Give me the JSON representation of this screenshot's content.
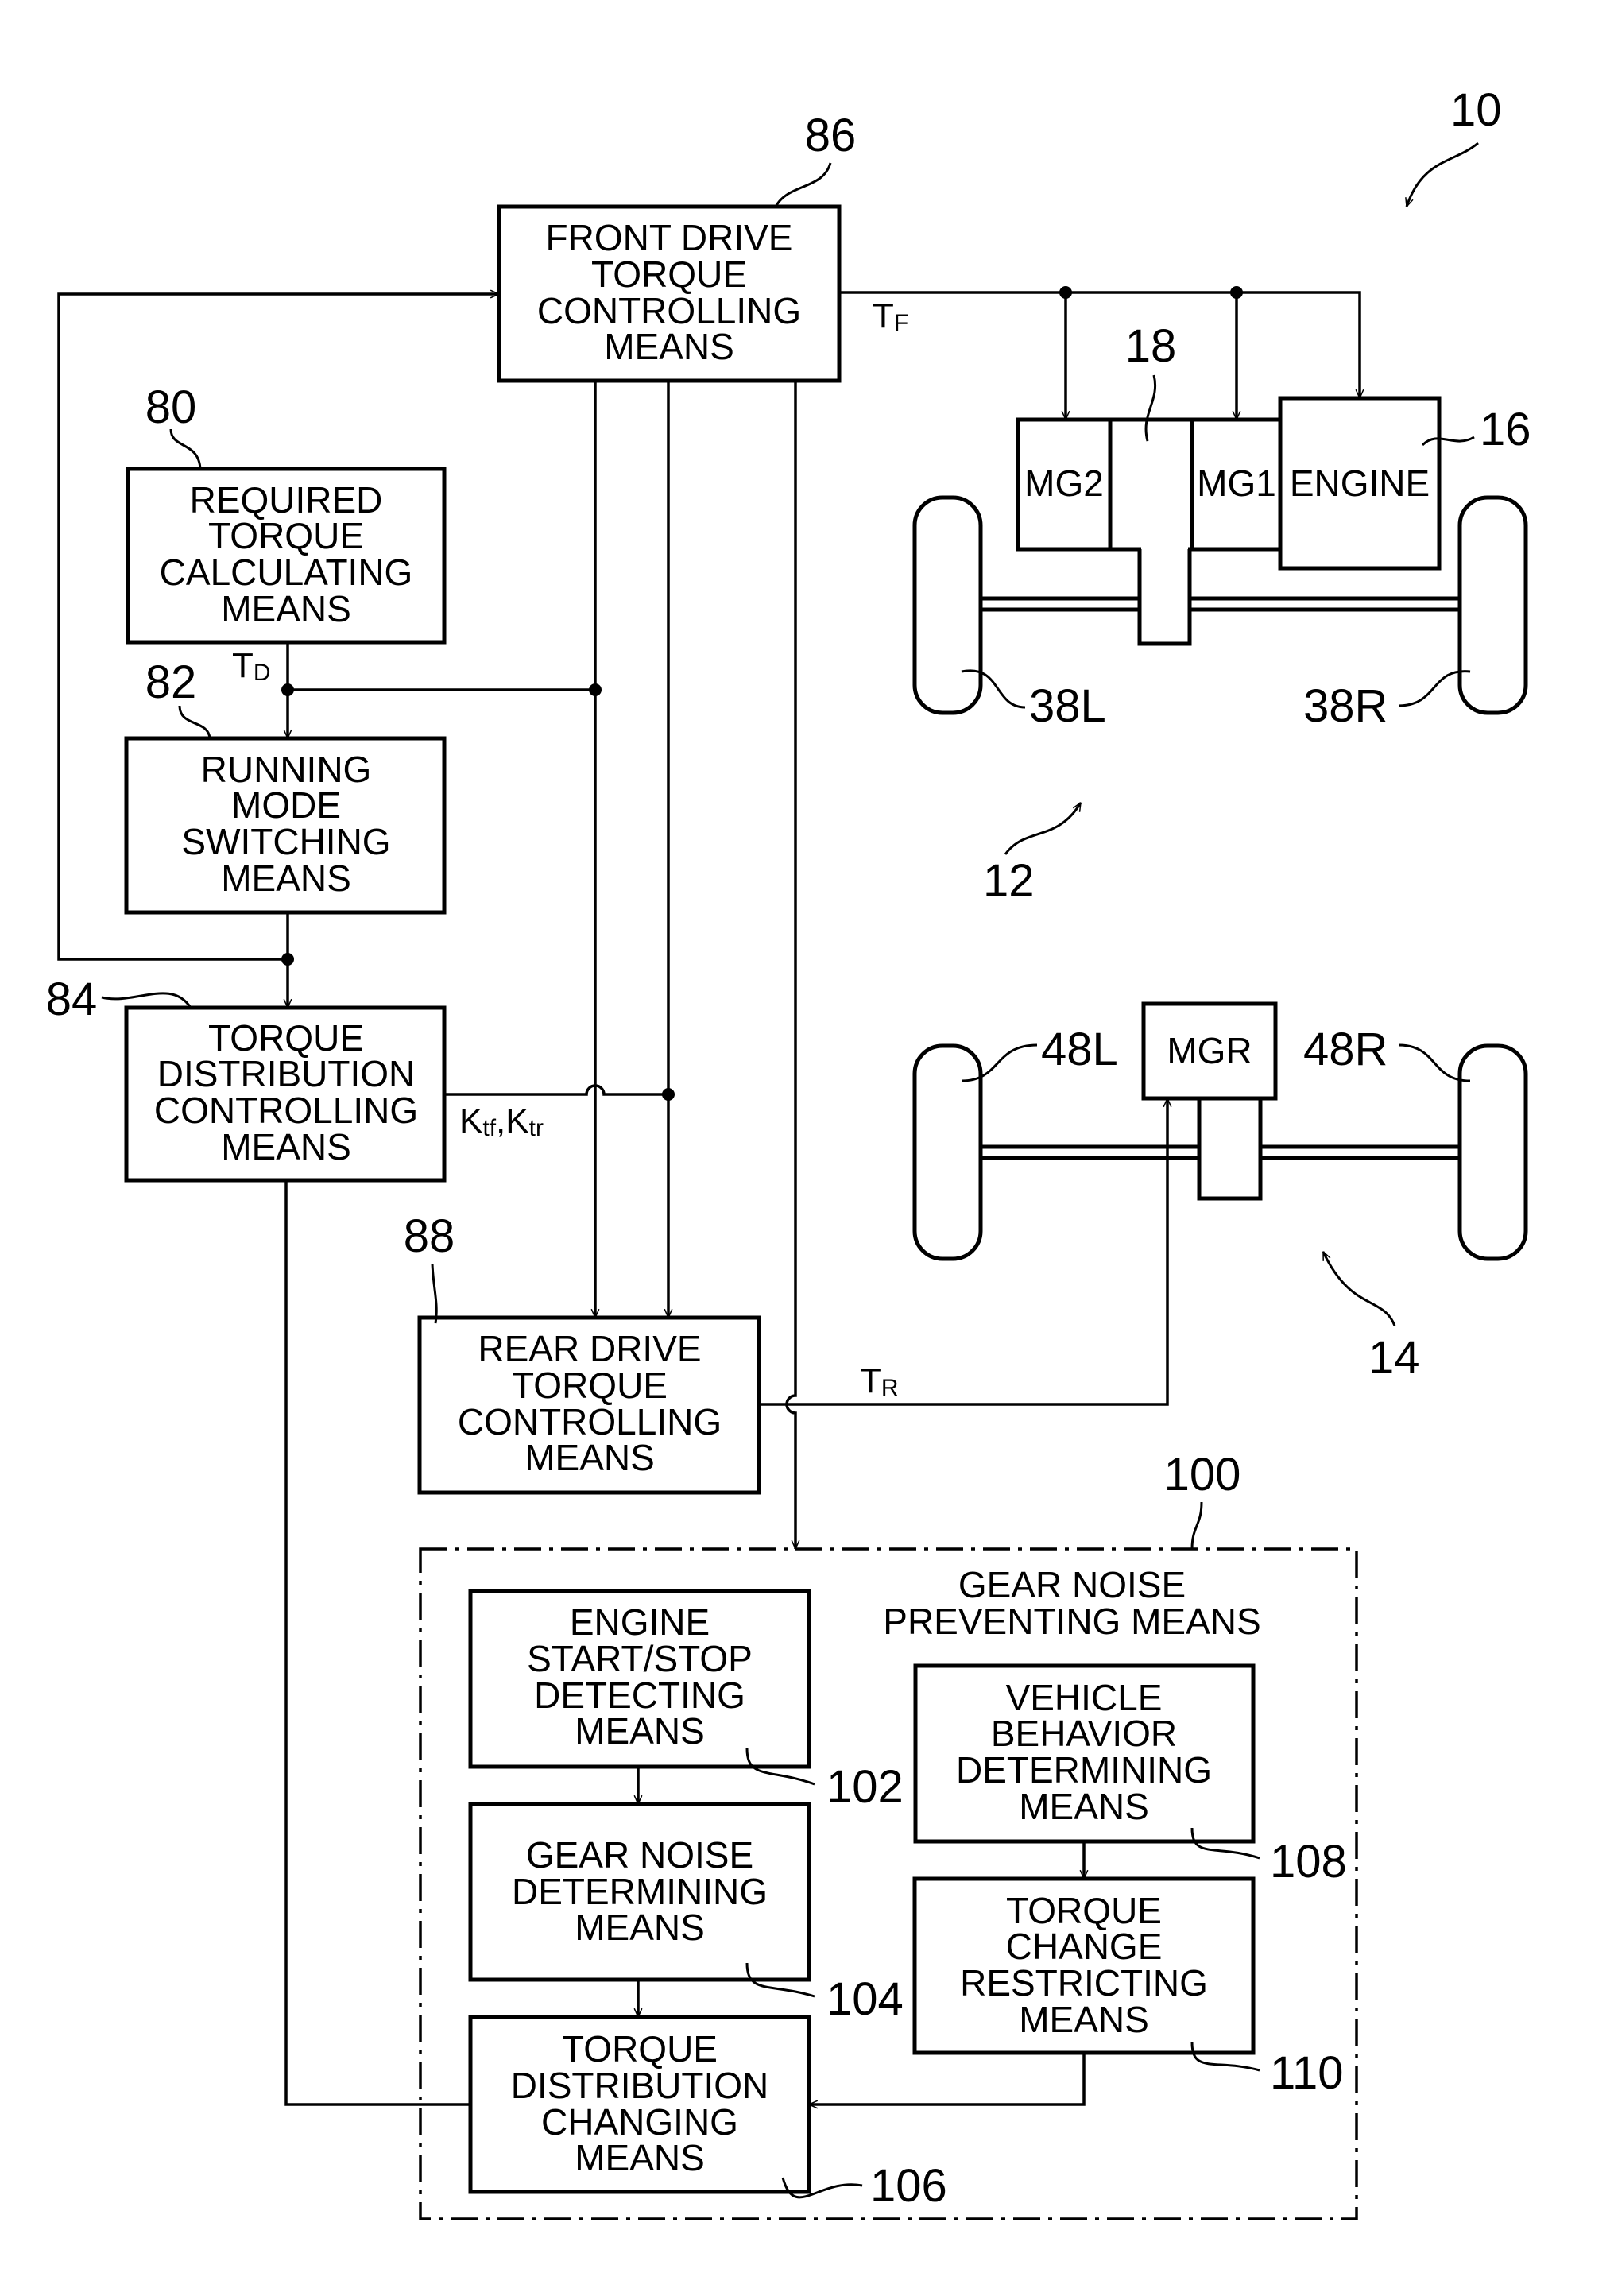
{
  "figure": {
    "ref_system": "10",
    "blocks": {
      "required_torque": {
        "ref": "80",
        "lines": [
          "REQUIRED",
          "TORQUE",
          "CALCULATING",
          "MEANS"
        ]
      },
      "running_mode": {
        "ref": "82",
        "lines": [
          "RUNNING",
          "MODE",
          "SWITCHING",
          "MEANS"
        ]
      },
      "torque_distribution_control": {
        "ref": "84",
        "lines": [
          "TORQUE",
          "DISTRIBUTION",
          "CONTROLLING",
          "MEANS"
        ]
      },
      "front_drive": {
        "ref": "86",
        "lines": [
          "FRONT DRIVE",
          "TORQUE",
          "CONTROLLING",
          "MEANS"
        ]
      },
      "rear_drive": {
        "ref": "88",
        "lines": [
          "REAR DRIVE",
          "TORQUE",
          "CONTROLLING",
          "MEANS"
        ]
      },
      "gear_noise_preventing": {
        "ref": "100",
        "lines": [
          "GEAR NOISE",
          "PREVENTING MEANS"
        ]
      },
      "engine_start_stop": {
        "ref": "102",
        "lines": [
          "ENGINE",
          "START/STOP",
          "DETECTING",
          "MEANS"
        ]
      },
      "gear_noise_determining": {
        "ref": "104",
        "lines": [
          "GEAR NOISE",
          "DETERMINING",
          "MEANS"
        ]
      },
      "torque_distribution_changing": {
        "ref": "106",
        "lines": [
          "TORQUE",
          "DISTRIBUTION",
          "CHANGING",
          "MEANS"
        ]
      },
      "vehicle_behavior": {
        "ref": "108",
        "lines": [
          "VEHICLE",
          "BEHAVIOR",
          "DETERMINING",
          "MEANS"
        ]
      },
      "torque_change_restricting": {
        "ref": "110",
        "lines": [
          "TORQUE",
          "CHANGE",
          "RESTRICTING",
          "MEANS"
        ]
      }
    },
    "signals": {
      "td": {
        "main": "T",
        "sub": "D"
      },
      "tf": {
        "main": "T",
        "sub": "F"
      },
      "tr": {
        "main": "T",
        "sub": "R"
      },
      "k": {
        "k1": "K",
        "k1_sub": "tf",
        "sep": ",",
        "k2": "K",
        "k2_sub": "tr"
      }
    },
    "front_drivetrain": {
      "ref": "12",
      "engine": {
        "ref": "16",
        "label": "ENGINE"
      },
      "mg1": "MG1",
      "mg2": "MG2",
      "transmission_ref": "18",
      "wheel_left": "38L",
      "wheel_right": "38R"
    },
    "rear_drivetrain": {
      "ref": "14",
      "mgr": "MGR",
      "wheel_left": "48L",
      "wheel_right": "48R"
    }
  }
}
